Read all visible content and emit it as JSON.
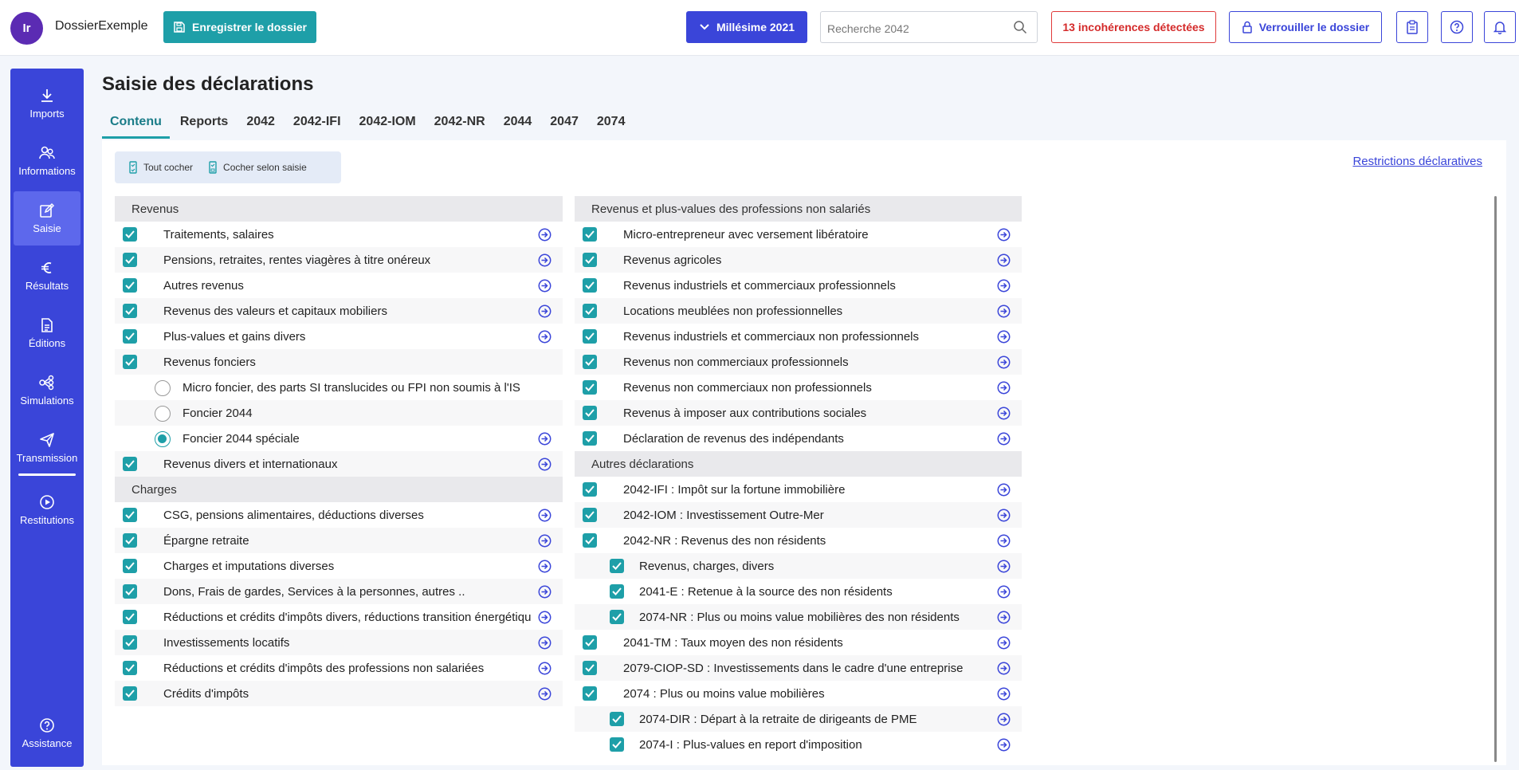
{
  "header": {
    "avatar_initials": "Ir",
    "app_title": "DossierExemple",
    "save_label": "Enregistrer le dossier",
    "year_label": "Millésime 2021",
    "search_placeholder": "Recherche 2042",
    "incoherences_label": "13 incohérences détectées",
    "lock_label": "Verrouiller le dossier",
    "icons": [
      "clipboard-icon",
      "help-icon",
      "bell-icon"
    ],
    "accent_color": "#3a45d9",
    "teal_color": "#1e9fa8"
  },
  "sidebar": {
    "items": [
      {
        "label": "Imports",
        "icon": "download-icon"
      },
      {
        "label": "Informations",
        "icon": "users-icon"
      },
      {
        "label": "Saisie",
        "icon": "edit-icon"
      },
      {
        "label": "Résultats",
        "icon": "euro-icon"
      },
      {
        "label": "Éditions",
        "icon": "document-icon"
      },
      {
        "label": "Simulations",
        "icon": "network-icon"
      },
      {
        "label": "Transmission",
        "icon": "send-icon"
      },
      {
        "label": "Restitutions",
        "icon": "play-icon"
      },
      {
        "label": "Assistance",
        "icon": "question-icon"
      }
    ],
    "active": "Saisie"
  },
  "main": {
    "title": "Saisie des déclarations",
    "tabs": [
      "Contenu",
      "Reports",
      "2042",
      "2042-IFI",
      "2042-IOM",
      "2042-NR",
      "2044",
      "2047",
      "2074"
    ],
    "active_tab": "Contenu",
    "toolbar": {
      "check_all": "Tout cocher",
      "check_by_input": "Cocher selon saisie"
    },
    "restrictions_link": "Restrictions déclaratives"
  },
  "left": {
    "revenus_title": "Revenus",
    "revenus": [
      "Traitements, salaires",
      "Pensions, retraites, rentes viagères à titre onéreux",
      "Autres revenus",
      "Revenus des valeurs et capitaux mobiliers",
      "Plus-values et gains divers",
      "Revenus fonciers"
    ],
    "fonciers_options": [
      "Micro foncier, des parts SI translucides ou FPI non soumis à l'IS",
      "Foncier 2044",
      "Foncier 2044 spéciale"
    ],
    "divers": "Revenus divers et internationaux",
    "charges_title": "Charges",
    "charges": [
      "CSG, pensions alimentaires, déductions diverses",
      "Épargne retraite",
      "Charges et imputations diverses",
      "Dons, Frais de gardes, Services à la personnes, autres ..",
      "Réductions et crédits d'impôts divers, réductions transition énergétique",
      "Investissements locatifs",
      "Réductions et crédits d'impôts des professions non salariées",
      "Crédits d'impôts"
    ]
  },
  "right": {
    "pro_title": "Revenus et plus-values des professions non salariés",
    "pro": [
      "Micro-entrepreneur avec versement libératoire",
      "Revenus agricoles",
      "Revenus industriels et commerciaux professionnels",
      "Locations meublées non professionnelles",
      "Revenus industriels et commerciaux non professionnels",
      "Revenus non commerciaux professionnels",
      "Revenus non commerciaux non professionnels",
      "Revenus à imposer aux contributions sociales",
      "Déclaration de revenus des indépendants"
    ],
    "autres_title": "Autres déclarations",
    "autres": [
      "2042-IFI : Impôt sur la fortune immobilière",
      "2042-IOM : Investissement Outre-Mer",
      "2042-NR : Revenus des non résidents"
    ],
    "nr_sub": [
      "Revenus, charges, divers",
      "2041-E : Retenue à la source des non résidents",
      "2074-NR : Plus ou moins value mobilières des non résidents"
    ],
    "autres2": [
      "2041-TM : Taux moyen des non résidents",
      "2079-CIOP-SD : Investissements dans le cadre d'une entreprise",
      "2074 : Plus ou moins value mobilières"
    ],
    "pv_sub": [
      "2074-DIR : Départ à la retraite de dirigeants de PME",
      "2074-I : Plus-values en report d'imposition"
    ]
  }
}
